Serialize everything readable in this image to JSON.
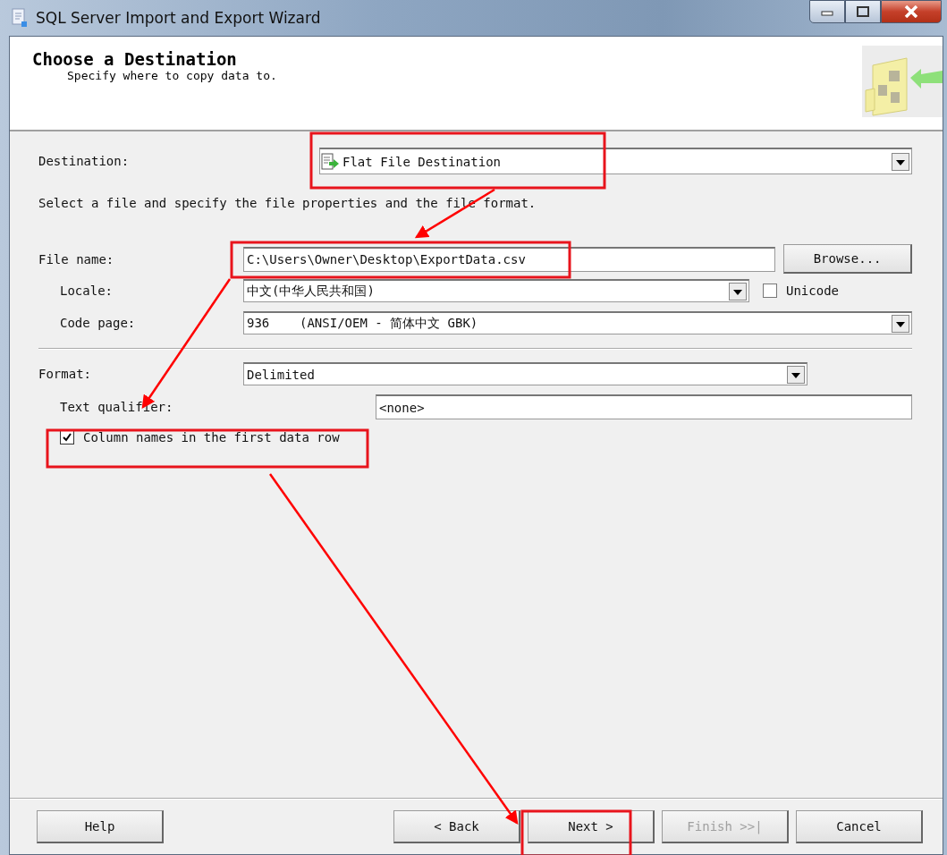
{
  "window": {
    "title": "SQL Server Import and Export Wizard"
  },
  "header": {
    "title": "Choose a Destination",
    "subtitle": "Specify where to copy data to."
  },
  "destination": {
    "label": "Destination:",
    "value": "Flat File Destination"
  },
  "instruction": "Select a file and specify the file properties and the file format.",
  "file_name": {
    "label": "File name:",
    "value": "C:\\Users\\Owner\\Desktop\\ExportData.csv"
  },
  "browse_button": "Browse...",
  "locale": {
    "label": "Locale:",
    "value": "中文(中华人民共和国)"
  },
  "unicode": {
    "label": "Unicode",
    "checked": false
  },
  "code_page": {
    "label": "Code page:",
    "value": "936    (ANSI/OEM - 简体中文 GBK)"
  },
  "format": {
    "label": "Format:",
    "value": "Delimited"
  },
  "text_qualifier": {
    "label": "Text qualifier:",
    "value": "<none>"
  },
  "column_names": {
    "label": "Column names in the first data row",
    "checked": true
  },
  "buttons": [
    {
      "label": "Help",
      "disabled": false
    },
    {
      "label": "< Back",
      "disabled": false
    },
    {
      "label": "Next >",
      "disabled": false
    },
    {
      "label": "Finish >>|",
      "disabled": true
    },
    {
      "label": "Cancel",
      "disabled": false
    }
  ]
}
